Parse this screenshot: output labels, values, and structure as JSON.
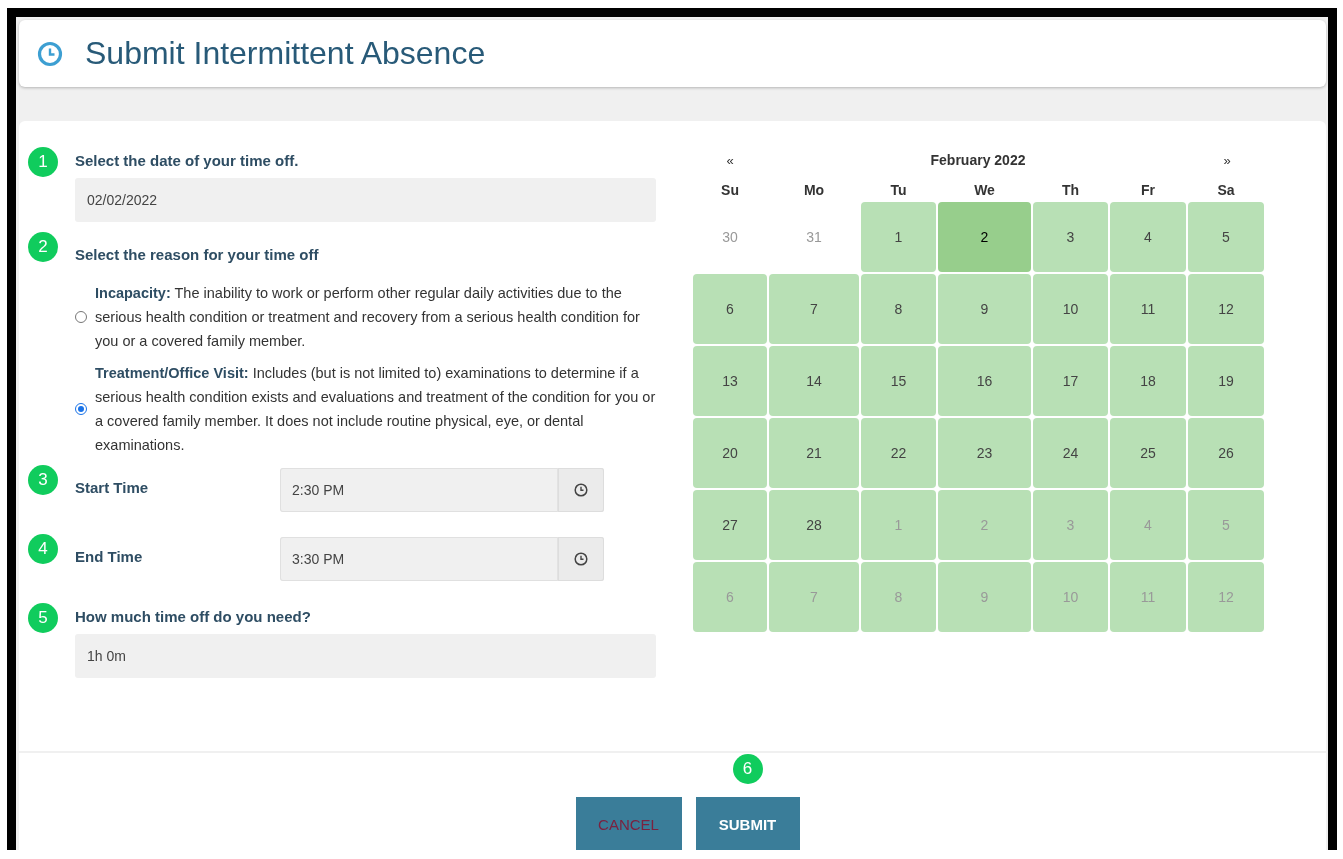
{
  "page_title": "Submit Intermittent Absence",
  "steps": [
    {
      "number": "1",
      "kind": "text",
      "label": "Select the date of your time off.",
      "value": "02/02/2022"
    },
    {
      "number": "2",
      "kind": "radio",
      "label": "Select the reason for your time off",
      "options": [
        {
          "text": "**Incapacity:** The inability to work or perform other regular daily activities due to the serious health condition or treatment and recovery from a serious health condition for you or a covered family member.",
          "selected": false
        },
        {
          "text": "**Treatment/Office Visit:** Includes (but is not limited to) examinations to determine if a serious health condition exists and evaluations and treatment of the condition for you or a covered family member. It does not include routine physical, eye, or dental examinations.",
          "selected": true
        }
      ]
    },
    {
      "number": "3",
      "kind": "time",
      "label": "Start Time",
      "value": "2:30 PM"
    },
    {
      "number": "4",
      "kind": "time",
      "label": "End Time",
      "value": "3:30 PM"
    },
    {
      "number": "5",
      "kind": "text",
      "label": "How much time off do you need?",
      "value": "1h 0m"
    }
  ],
  "calendar": {
    "prev": "«",
    "title": "February 2022",
    "next": "»",
    "weekdays": [
      "Su",
      "Mo",
      "Tu",
      "We",
      "Th",
      "Fr",
      "Sa"
    ],
    "days": [
      {
        "label": "30",
        "muted": true,
        "highlighted": false,
        "selected": false
      },
      {
        "label": "31",
        "muted": true,
        "highlighted": false,
        "selected": false
      },
      {
        "label": "1",
        "muted": false,
        "highlighted": true,
        "selected": false
      },
      {
        "label": "2",
        "muted": false,
        "highlighted": true,
        "selected": true
      },
      {
        "label": "3",
        "muted": false,
        "highlighted": true,
        "selected": false
      },
      {
        "label": "4",
        "muted": false,
        "highlighted": true,
        "selected": false
      },
      {
        "label": "5",
        "muted": false,
        "highlighted": true,
        "selected": false
      },
      {
        "label": "6",
        "muted": false,
        "highlighted": true,
        "selected": false
      },
      {
        "label": "7",
        "muted": false,
        "highlighted": true,
        "selected": false
      },
      {
        "label": "8",
        "muted": false,
        "highlighted": true,
        "selected": false
      },
      {
        "label": "9",
        "muted": false,
        "highlighted": true,
        "selected": false
      },
      {
        "label": "10",
        "muted": false,
        "highlighted": true,
        "selected": false
      },
      {
        "label": "11",
        "muted": false,
        "highlighted": true,
        "selected": false
      },
      {
        "label": "12",
        "muted": false,
        "highlighted": true,
        "selected": false
      },
      {
        "label": "13",
        "muted": false,
        "highlighted": true,
        "selected": false
      },
      {
        "label": "14",
        "muted": false,
        "highlighted": true,
        "selected": false
      },
      {
        "label": "15",
        "muted": false,
        "highlighted": true,
        "selected": false
      },
      {
        "label": "16",
        "muted": false,
        "highlighted": true,
        "selected": false
      },
      {
        "label": "17",
        "muted": false,
        "highlighted": true,
        "selected": false
      },
      {
        "label": "18",
        "muted": false,
        "highlighted": true,
        "selected": false
      },
      {
        "label": "19",
        "muted": false,
        "highlighted": true,
        "selected": false
      },
      {
        "label": "20",
        "muted": false,
        "highlighted": true,
        "selected": false
      },
      {
        "label": "21",
        "muted": false,
        "highlighted": true,
        "selected": false
      },
      {
        "label": "22",
        "muted": false,
        "highlighted": true,
        "selected": false
      },
      {
        "label": "23",
        "muted": false,
        "highlighted": true,
        "selected": false
      },
      {
        "label": "24",
        "muted": false,
        "highlighted": true,
        "selected": false
      },
      {
        "label": "25",
        "muted": false,
        "highlighted": true,
        "selected": false
      },
      {
        "label": "26",
        "muted": false,
        "highlighted": true,
        "selected": false
      },
      {
        "label": "27",
        "muted": false,
        "highlighted": true,
        "selected": false
      },
      {
        "label": "28",
        "muted": false,
        "highlighted": true,
        "selected": false
      },
      {
        "label": "1",
        "muted": true,
        "highlighted": true,
        "selected": false
      },
      {
        "label": "2",
        "muted": true,
        "highlighted": true,
        "selected": false
      },
      {
        "label": "3",
        "muted": true,
        "highlighted": true,
        "selected": false
      },
      {
        "label": "4",
        "muted": true,
        "highlighted": true,
        "selected": false
      },
      {
        "label": "5",
        "muted": true,
        "highlighted": true,
        "selected": false
      },
      {
        "label": "6",
        "muted": true,
        "highlighted": true,
        "selected": false
      },
      {
        "label": "7",
        "muted": true,
        "highlighted": true,
        "selected": false
      },
      {
        "label": "8",
        "muted": true,
        "highlighted": true,
        "selected": false
      },
      {
        "label": "9",
        "muted": true,
        "highlighted": true,
        "selected": false
      },
      {
        "label": "10",
        "muted": true,
        "highlighted": true,
        "selected": false
      },
      {
        "label": "11",
        "muted": true,
        "highlighted": true,
        "selected": false
      },
      {
        "label": "12",
        "muted": true,
        "highlighted": true,
        "selected": false
      }
    ]
  },
  "footer": {
    "number": "6",
    "buttons": [
      {
        "kind": "cancel",
        "label": "CANCEL"
      },
      {
        "kind": "submit",
        "label": "SUBMIT"
      }
    ]
  }
}
